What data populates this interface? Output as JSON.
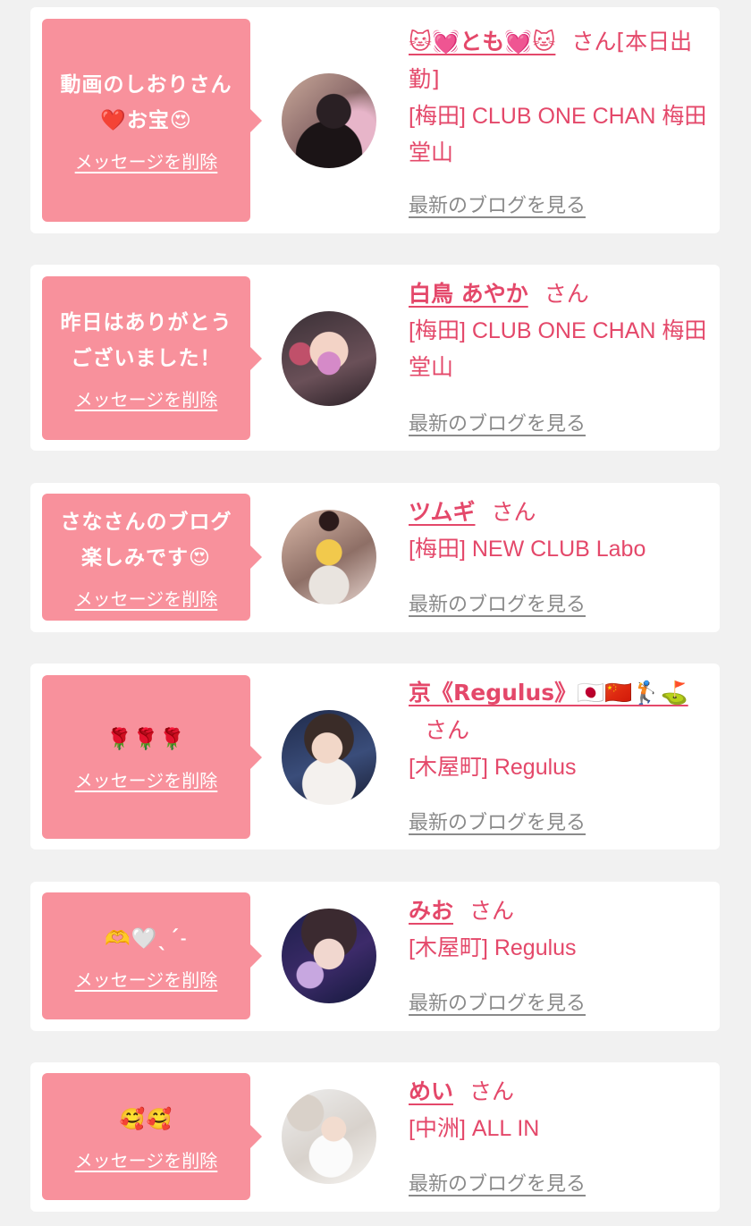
{
  "colors": {
    "accent": "#e4486a",
    "bubble": "#f8919c",
    "link_gray": "#8a8a8a",
    "background": "#f1f1f1"
  },
  "delete_label": "メッセージを削除",
  "blog_label": "最新のブログを見る",
  "cards": [
    {
      "message": "動画のしおりさん\n❤️お宝😍",
      "name": "🐱💓とも💓🐱",
      "honorific": "さん[本日出勤]",
      "shop": "[梅田] CLUB ONE CHAN 梅田堂山"
    },
    {
      "message": "昨日はありがとう\nございました！",
      "name": "白鳥 あやか",
      "honorific": "さん",
      "shop": "[梅田] CLUB ONE CHAN 梅田堂山"
    },
    {
      "message": "さなさんのブログ\n楽しみです😍",
      "name": "ツムギ",
      "honorific": "さん",
      "shop": "[梅田] NEW CLUB Labo"
    },
    {
      "message": "🌹🌹🌹",
      "name": "京《Regulus》🇯🇵🇨🇳🏌️⛳",
      "honorific": "さん",
      "shop": "[木屋町] Regulus"
    },
    {
      "message": "🫶🤍ˎˊ˗",
      "name": "みお",
      "honorific": "さん",
      "shop": "[木屋町] Regulus"
    },
    {
      "message": "🥰🥰",
      "name": "めい",
      "honorific": "さん",
      "shop": "[中洲] ALL IN"
    }
  ]
}
